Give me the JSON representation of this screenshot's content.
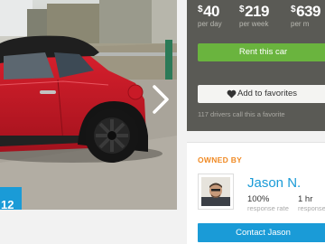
{
  "photo": {
    "counter": "12",
    "icons": {
      "next": "chevron-right-icon"
    }
  },
  "pricing": {
    "currency": "$",
    "day": {
      "amount": "40",
      "period": "per day"
    },
    "week": {
      "amount": "219",
      "period": "per week"
    },
    "month": {
      "amount": "639",
      "period": "per m"
    }
  },
  "actions": {
    "rent_label": "Rent this car",
    "favorite_label": "Add to favorites",
    "favorite_icon": "heart-icon",
    "favorite_count_text": "117 drivers call this a favorite"
  },
  "owner": {
    "heading": "OWNED BY",
    "name": "Jason N.",
    "response_rate_value": "100%",
    "response_rate_label": "response rate",
    "response_time_value": "1 hr",
    "response_time_label": "response",
    "contact_label": "Contact Jason"
  },
  "colors": {
    "accent_blue": "#1a9bd7",
    "rent_green": "#6ab43e",
    "owner_orange": "#f08a24",
    "panel_dark": "#5a5a55"
  }
}
